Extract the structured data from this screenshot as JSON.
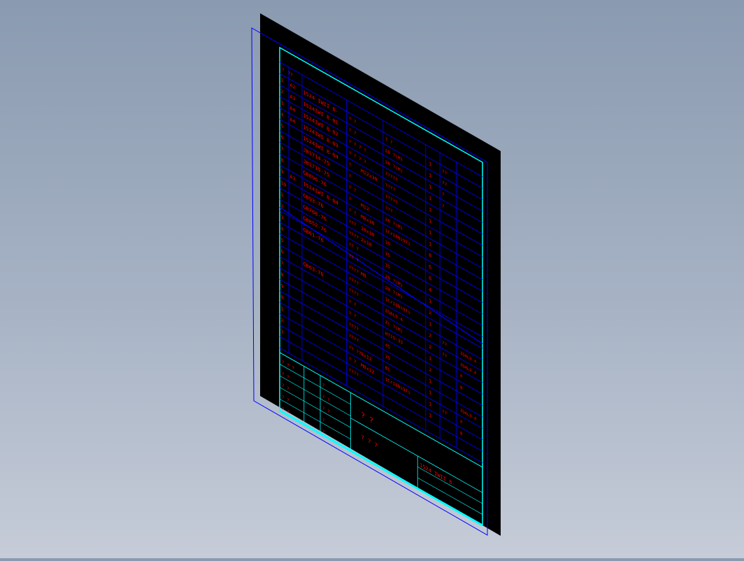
{
  "view": {
    "background_top": "#8a9ab0",
    "background_bottom": "#c6ccd8",
    "sheet_color": "#000000",
    "frame_color": "#0000ff",
    "border_color": "#00ffff",
    "text_color": "#ff0000"
  },
  "bom": {
    "header": [
      "?",
      "??"
    ],
    "index_col": [
      "1",
      "2",
      "3",
      "4",
      "5",
      "6",
      "7",
      "8",
      "9",
      "10",
      "1",
      "2",
      "3",
      "4",
      "5",
      "6",
      "7",
      "8",
      "9",
      "0",
      "1",
      "2",
      "3"
    ],
    "size_col": [
      "A2",
      "A3",
      "A4",
      "A4",
      "",
      "",
      "",
      "",
      "A3",
      "",
      "",
      "",
      "",
      "",
      "",
      "",
      "",
      "",
      "",
      "",
      "",
      "",
      ""
    ],
    "codes": [
      "1524 IWII 8-",
      "1524IWI 8-01",
      "1524IWI 8-02",
      "1524IWI 8-03",
      "1524IWI 8-04",
      "JB1714-75",
      "JB1715-75",
      "GB896-76",
      "1524IWI 8-04",
      "GB93-76",
      "GB788-76",
      "GB852-76",
      "GB61-76",
      "",
      "",
      "GB63-76"
    ],
    "names": [
      "? ?",
      "? ?",
      "? ? ? ?",
      "? ? ? ?",
      "?",
      "?",
      "? ?",
      "?",
      "? ?",
      "???",
      "????",
      "?? ?",
      "?? ?",
      "????",
      "????",
      "????",
      "? ?",
      "? ?",
      "????",
      "????",
      "?? ??",
      "? ?",
      "????"
    ],
    "specs": [
      "",
      "",
      "",
      "",
      "M12x30",
      "",
      "",
      "M12",
      "M8x30",
      "10x30",
      "2x10",
      "",
      "",
      "M8",
      "",
      "",
      "",
      "",
      "",
      "",
      "8x12",
      "M8x12",
      ""
    ],
    "materials": [
      "? ?",
      "28 ?(M)",
      "28 ?(M)",
      "?????",
      "????",
      "?????",
      "???",
      "28 ?(M)",
      "1Cr18Ni9Ti",
      "35",
      "35",
      "35",
      "20 ?(M)",
      "20 ?(M)",
      "1Cr18Ni9Ti",
      "ZQAL9-4",
      "Zc ?(M)",
      "HT15-33",
      "45",
      "35",
      "BL",
      "1Cr18Ni9Ti",
      ""
    ],
    "qty": [
      "1",
      "1",
      "1",
      "1",
      "1",
      "1",
      "1",
      "1",
      "8",
      "6",
      "6",
      "4",
      "1",
      "2",
      "1",
      "2",
      "2",
      "1",
      "2",
      "1",
      "1",
      "1",
      "1"
    ],
    "remarks": [
      "??",
      "??",
      "?",
      "?",
      "",
      "",
      "",
      "",
      "",
      "",
      "",
      "",
      "",
      "",
      "",
      "??",
      "??",
      "",
      "",
      "",
      "",
      "??",
      ""
    ],
    "weights": [
      "",
      "",
      "",
      "",
      "",
      "",
      "",
      "",
      "",
      "",
      "",
      "",
      "",
      "",
      "",
      "ZQAL9-4",
      "ZQAL9-4",
      "P",
      "B",
      "",
      "ZQAL9-4",
      "P",
      "B"
    ]
  },
  "title_block": {
    "left_rows": [
      "?  ?  ?",
      "? ?",
      "? ?",
      "? ?",
      "? ?"
    ],
    "mid_rows": [
      "?",
      "? ?",
      "? ?",
      "?",
      "?"
    ],
    "title": "? ?",
    "subtitle": "? ? ?",
    "drawing_no": "1524 IWII 8-"
  }
}
